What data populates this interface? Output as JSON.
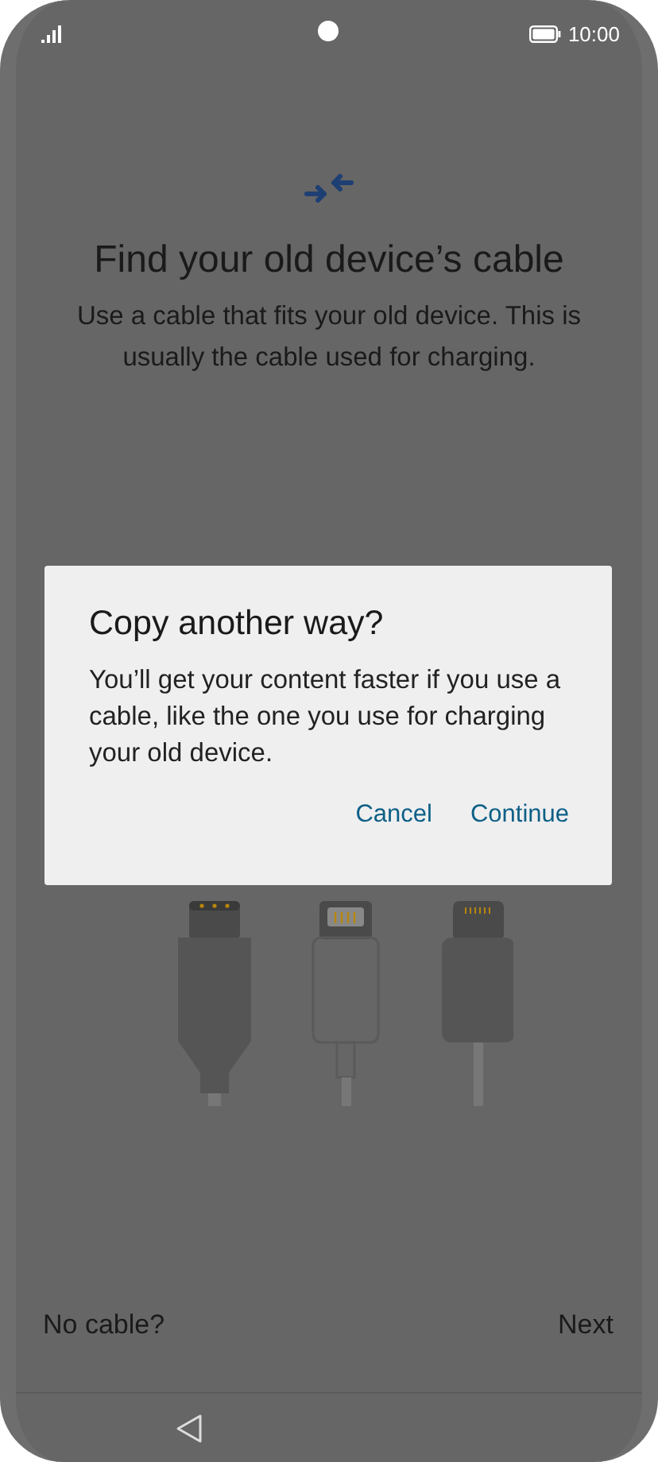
{
  "status_bar": {
    "time": "10:00"
  },
  "screen": {
    "title": "Find your old device’s cable",
    "body": "Use a cable that fits your old device. This is usually the cable used for charging."
  },
  "bottom_actions": [
    "No cable?",
    "Next"
  ],
  "dialog": {
    "title": "Copy another way?",
    "message": "You’ll get your content faster if you use a cable, like the one you use for charging your old device.",
    "buttons": [
      "Cancel",
      "Continue"
    ]
  }
}
